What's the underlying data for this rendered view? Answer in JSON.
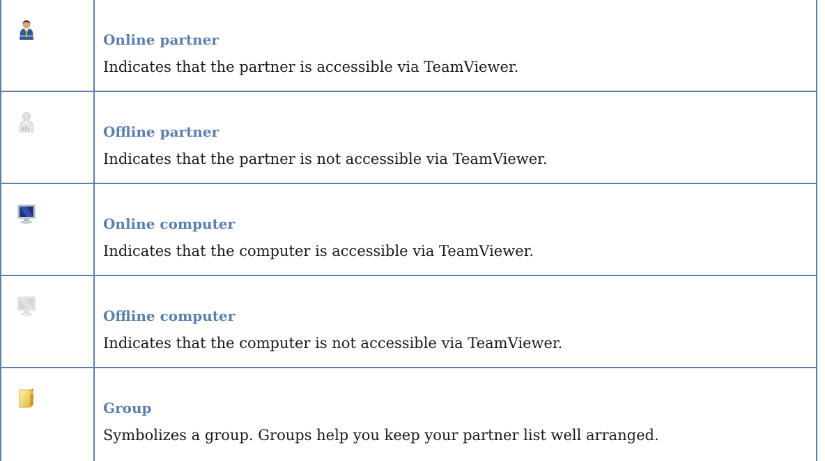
{
  "legend": {
    "rows": [
      {
        "icon": "online-partner-icon",
        "title": "Online partner",
        "description": "Indicates that the partner is accessible via TeamViewer."
      },
      {
        "icon": "offline-partner-icon",
        "title": "Offline partner",
        "description": "Indicates that the partner is not accessible via TeamViewer."
      },
      {
        "icon": "online-computer-icon",
        "title": "Online computer",
        "description": "Indicates that the computer is accessible via TeamViewer."
      },
      {
        "icon": "offline-computer-icon",
        "title": "Offline computer",
        "description": "Indicates that the computer is not accessible via TeamViewer."
      },
      {
        "icon": "group-folder-icon",
        "title": "Group",
        "description": "Symbolizes a group.  Groups help you keep your partner list well arranged."
      }
    ]
  }
}
